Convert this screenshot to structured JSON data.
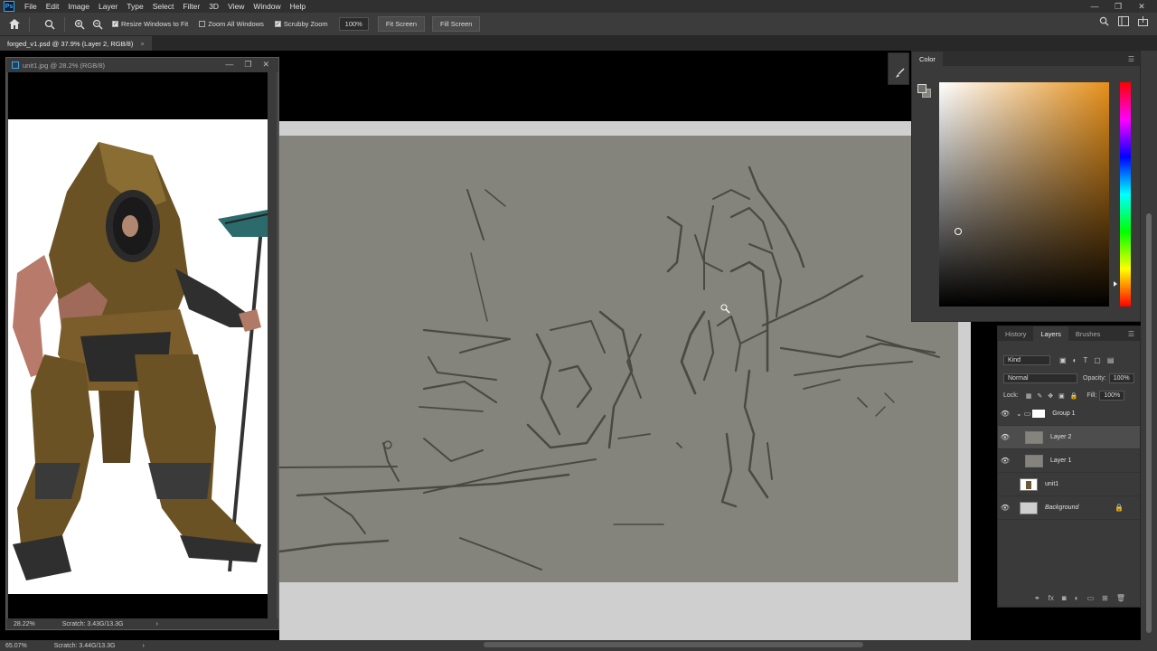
{
  "app": {
    "logo": "Ps",
    "menus": [
      "File",
      "Edit",
      "Image",
      "Layer",
      "Type",
      "Select",
      "Filter",
      "3D",
      "View",
      "Window",
      "Help"
    ],
    "window_controls": {
      "minimize": "—",
      "restore": "❐",
      "close": "✕"
    }
  },
  "options": {
    "resize_windows_label": "Resize Windows to Fit",
    "zoom_all_label": "Zoom All Windows",
    "scrubby_zoom_label": "Scrubby Zoom",
    "zoom_value": "100%",
    "fit_screen_label": "Fit Screen",
    "fill_screen_label": "Fill Screen",
    "checks": {
      "resize": "✓",
      "zoom_all": "",
      "scrubby": "✓"
    }
  },
  "document": {
    "tab_title": "forged_v1.psd @ 37.9% (Layer 2, RGB/8)",
    "tab_close": "×",
    "zoom_status": "65.07%",
    "scratch_status": "Scratch: 3.44G/13.3G",
    "status_arrow": "›"
  },
  "reference_window": {
    "title": "unit1.jpg @ 28.2% (RGB/8)",
    "zoom_status": "28.22%",
    "scratch_status": "Scratch: 3.43G/13.3G",
    "status_arrow": "›",
    "controls": {
      "minimize": "—",
      "restore": "❐",
      "close": "✕"
    }
  },
  "color_panel": {
    "tab": "Color",
    "fg_color": "#6e6d66",
    "bg_color": "#85847c",
    "hue_color": "#e6901a"
  },
  "layers_panel": {
    "tabs": [
      "History",
      "Layers",
      "Brushes"
    ],
    "active_tab": "Layers",
    "filter_kind": "Kind",
    "blend_mode": "Normal",
    "opacity_label": "Opacity:",
    "opacity_value": "100%",
    "lock_label": "Lock:",
    "fill_label": "Fill:",
    "fill_value": "100%",
    "layers": [
      {
        "name": "Group 1",
        "visible": true,
        "type": "group"
      },
      {
        "name": "Layer 2",
        "visible": true,
        "type": "pixel",
        "selected": true
      },
      {
        "name": "Layer 1",
        "visible": true,
        "type": "pixel"
      },
      {
        "name": "unit1",
        "visible": false,
        "type": "image"
      },
      {
        "name": "Background",
        "visible": true,
        "type": "background",
        "locked": true
      }
    ]
  },
  "colors": {
    "canvas": "#85847c",
    "accent": "#31a8ff"
  }
}
